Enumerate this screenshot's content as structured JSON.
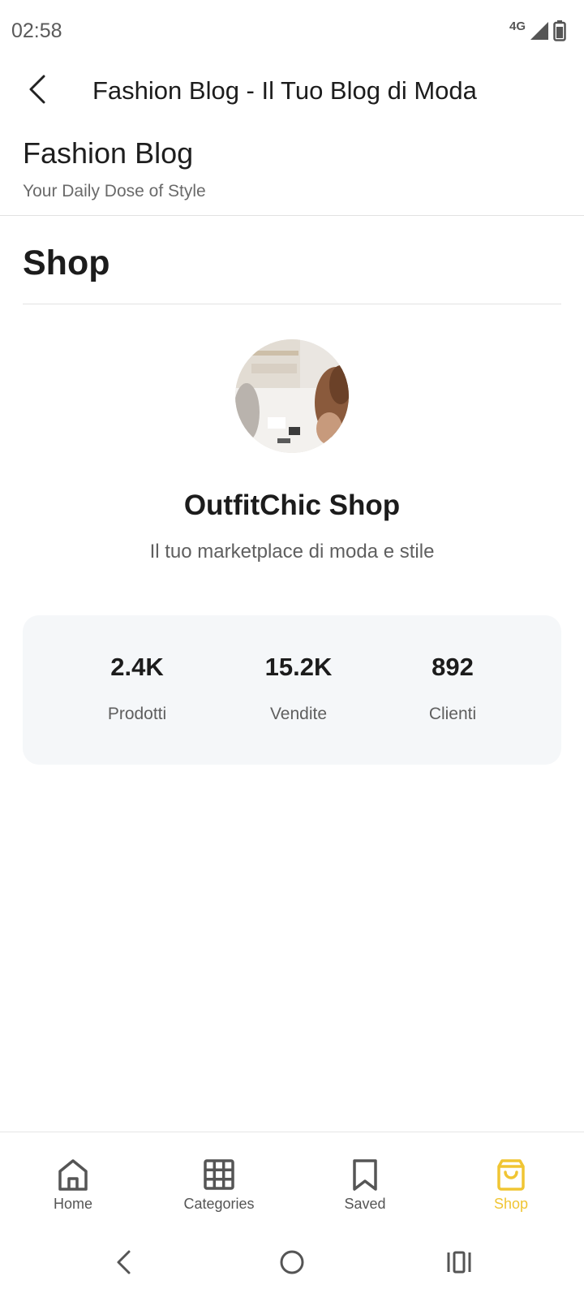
{
  "status_bar": {
    "time": "02:58",
    "network": "4G",
    "icons": [
      "signal-icon",
      "battery-icon"
    ]
  },
  "app_bar": {
    "title": "Fashion Blog - Il Tuo Blog di Moda",
    "back_icon": "chevron-left-icon"
  },
  "blog": {
    "name": "Fashion Blog",
    "tagline": "Your Daily Dose of Style"
  },
  "section": {
    "title": "Shop"
  },
  "shop": {
    "name": "OutfitChic Shop",
    "description": "Il tuo marketplace di moda e stile",
    "stats": [
      {
        "value": "2.4K",
        "label": "Prodotti"
      },
      {
        "value": "15.2K",
        "label": "Vendite"
      },
      {
        "value": "892",
        "label": "Clienti"
      }
    ]
  },
  "bottom_nav": {
    "items": [
      {
        "label": "Home",
        "icon": "home-icon",
        "active": false
      },
      {
        "label": "Categories",
        "icon": "grid-icon",
        "active": false
      },
      {
        "label": "Saved",
        "icon": "bookmark-icon",
        "active": false
      },
      {
        "label": "Shop",
        "icon": "shopping-bag-icon",
        "active": true
      }
    ],
    "active_color": "#F0C533",
    "inactive_color": "#555555"
  },
  "system_nav": {
    "icons": [
      "back-icon",
      "home-circle-icon",
      "recents-icon"
    ]
  }
}
